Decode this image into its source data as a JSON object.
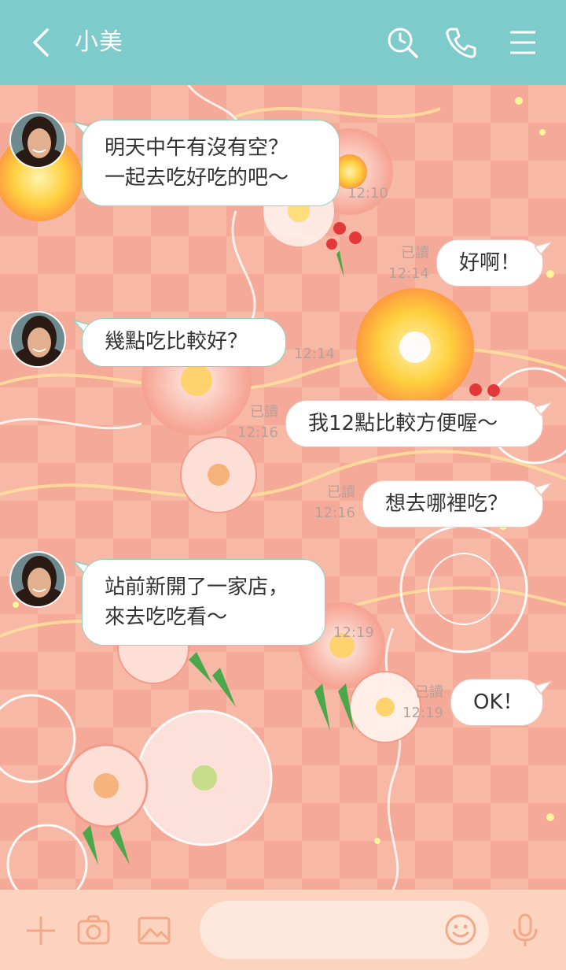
{
  "header": {
    "back_icon": "chevron-left-icon",
    "title": "小美",
    "search_icon": "search-icon",
    "call_icon": "phone-icon",
    "menu_icon": "hamburger-menu-icon",
    "color": "#7dcbca"
  },
  "messages": [
    {
      "side": "in",
      "lines": [
        "明天中午有沒有空？",
        "一起去吃好吃的吧〜"
      ],
      "time": "12:10"
    },
    {
      "side": "out",
      "text": "好啊！",
      "read": "已讀",
      "time": "12:14"
    },
    {
      "side": "in",
      "text": "幾點吃比較好？",
      "time": "12:14"
    },
    {
      "side": "out",
      "text": "我12點比較方便喔〜",
      "read": "已讀",
      "time": "12:16"
    },
    {
      "side": "out",
      "text": "想去哪裡吃？",
      "read": "已讀",
      "time": "12:16"
    },
    {
      "side": "in",
      "lines": [
        "站前新開了一家店，",
        "來去吃吃看〜"
      ],
      "time": "12:19"
    },
    {
      "side": "out",
      "text": "OK！",
      "read": "已讀",
      "time": "12:19"
    }
  ],
  "footer": {
    "plus_icon": "plus-icon",
    "camera_icon": "camera-icon",
    "image_icon": "image-icon",
    "emoji_icon": "smiley-icon",
    "mic_icon": "microphone-icon",
    "input_value": "",
    "icon_color": "#f3a887"
  }
}
